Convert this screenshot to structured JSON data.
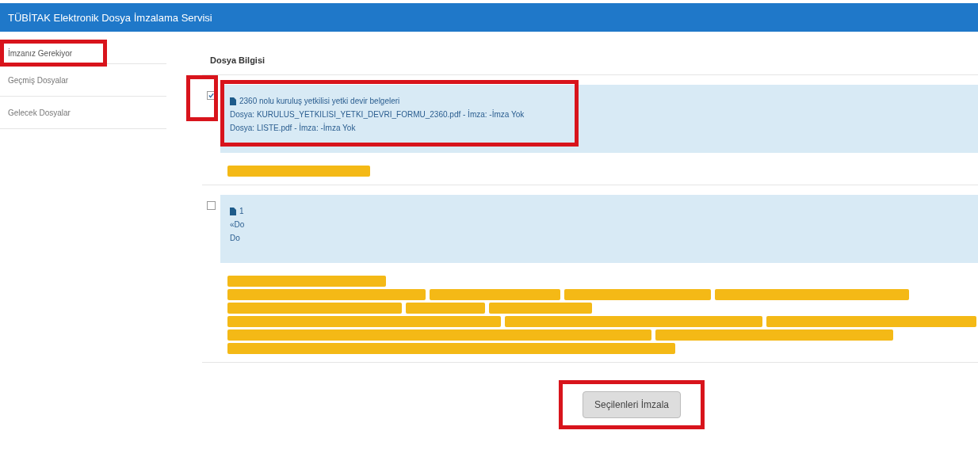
{
  "header": {
    "title": "TÜBİTAK Elektronik Dosya İmzalama Servisi"
  },
  "sidebar": {
    "items": [
      {
        "label": "İmzanız Gerekiyor",
        "selected": true,
        "highlighted": true
      },
      {
        "label": "Geçmiş Dosyalar",
        "selected": false,
        "highlighted": false
      },
      {
        "label": "Gelecek Dosyalar",
        "selected": false,
        "highlighted": false
      }
    ]
  },
  "main": {
    "heading": "Dosya Bilgisi",
    "files": [
      {
        "checked": true,
        "highlighted": true,
        "title": "2360 nolu kuruluş yetkilisi yetki devir belgeleri",
        "lines": [
          "Dosya: KURULUS_YETKILISI_YETKI_DEVRI_FORMU_2360.pdf - İmza: -İmza Yok",
          "Dosya: LISTE.pdf - İmza: -İmza Yok"
        ],
        "redacted": true
      },
      {
        "checked": false,
        "highlighted": false,
        "title": "1",
        "lines": [
          "«Do",
          "Do"
        ],
        "redacted": true
      }
    ],
    "button": {
      "label": "Seçilenleri İmzala",
      "highlighted": true
    }
  }
}
